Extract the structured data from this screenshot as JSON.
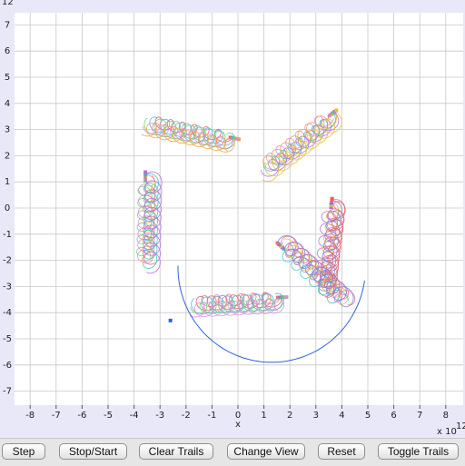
{
  "plot": {
    "x_axis_label": "x",
    "x_scale_label": "x 10",
    "x_scale_exponent": "12",
    "y_scale_exponent": "12",
    "x_ticks": [
      "-8",
      "-7",
      "-6",
      "-5",
      "-4",
      "-3",
      "-2",
      "-1",
      "0",
      "1",
      "2",
      "3",
      "4",
      "5",
      "6",
      "7",
      "8"
    ],
    "y_ticks": [
      "7",
      "6",
      "5",
      "4",
      "3",
      "2",
      "1",
      "0",
      "-1",
      "-2",
      "-3",
      "-4",
      "-5",
      "-6",
      "-7"
    ],
    "colors": {
      "background": "#ffffff",
      "grid": "#c8c8c8",
      "frame": "#e8e8f8"
    }
  },
  "toolbar": {
    "step": "Step",
    "stop_start": "Stop/Start",
    "clear_trails": "Clear Trails",
    "change_view": "Change View",
    "reset": "Reset",
    "toggle_trails": "Toggle Trails"
  }
}
